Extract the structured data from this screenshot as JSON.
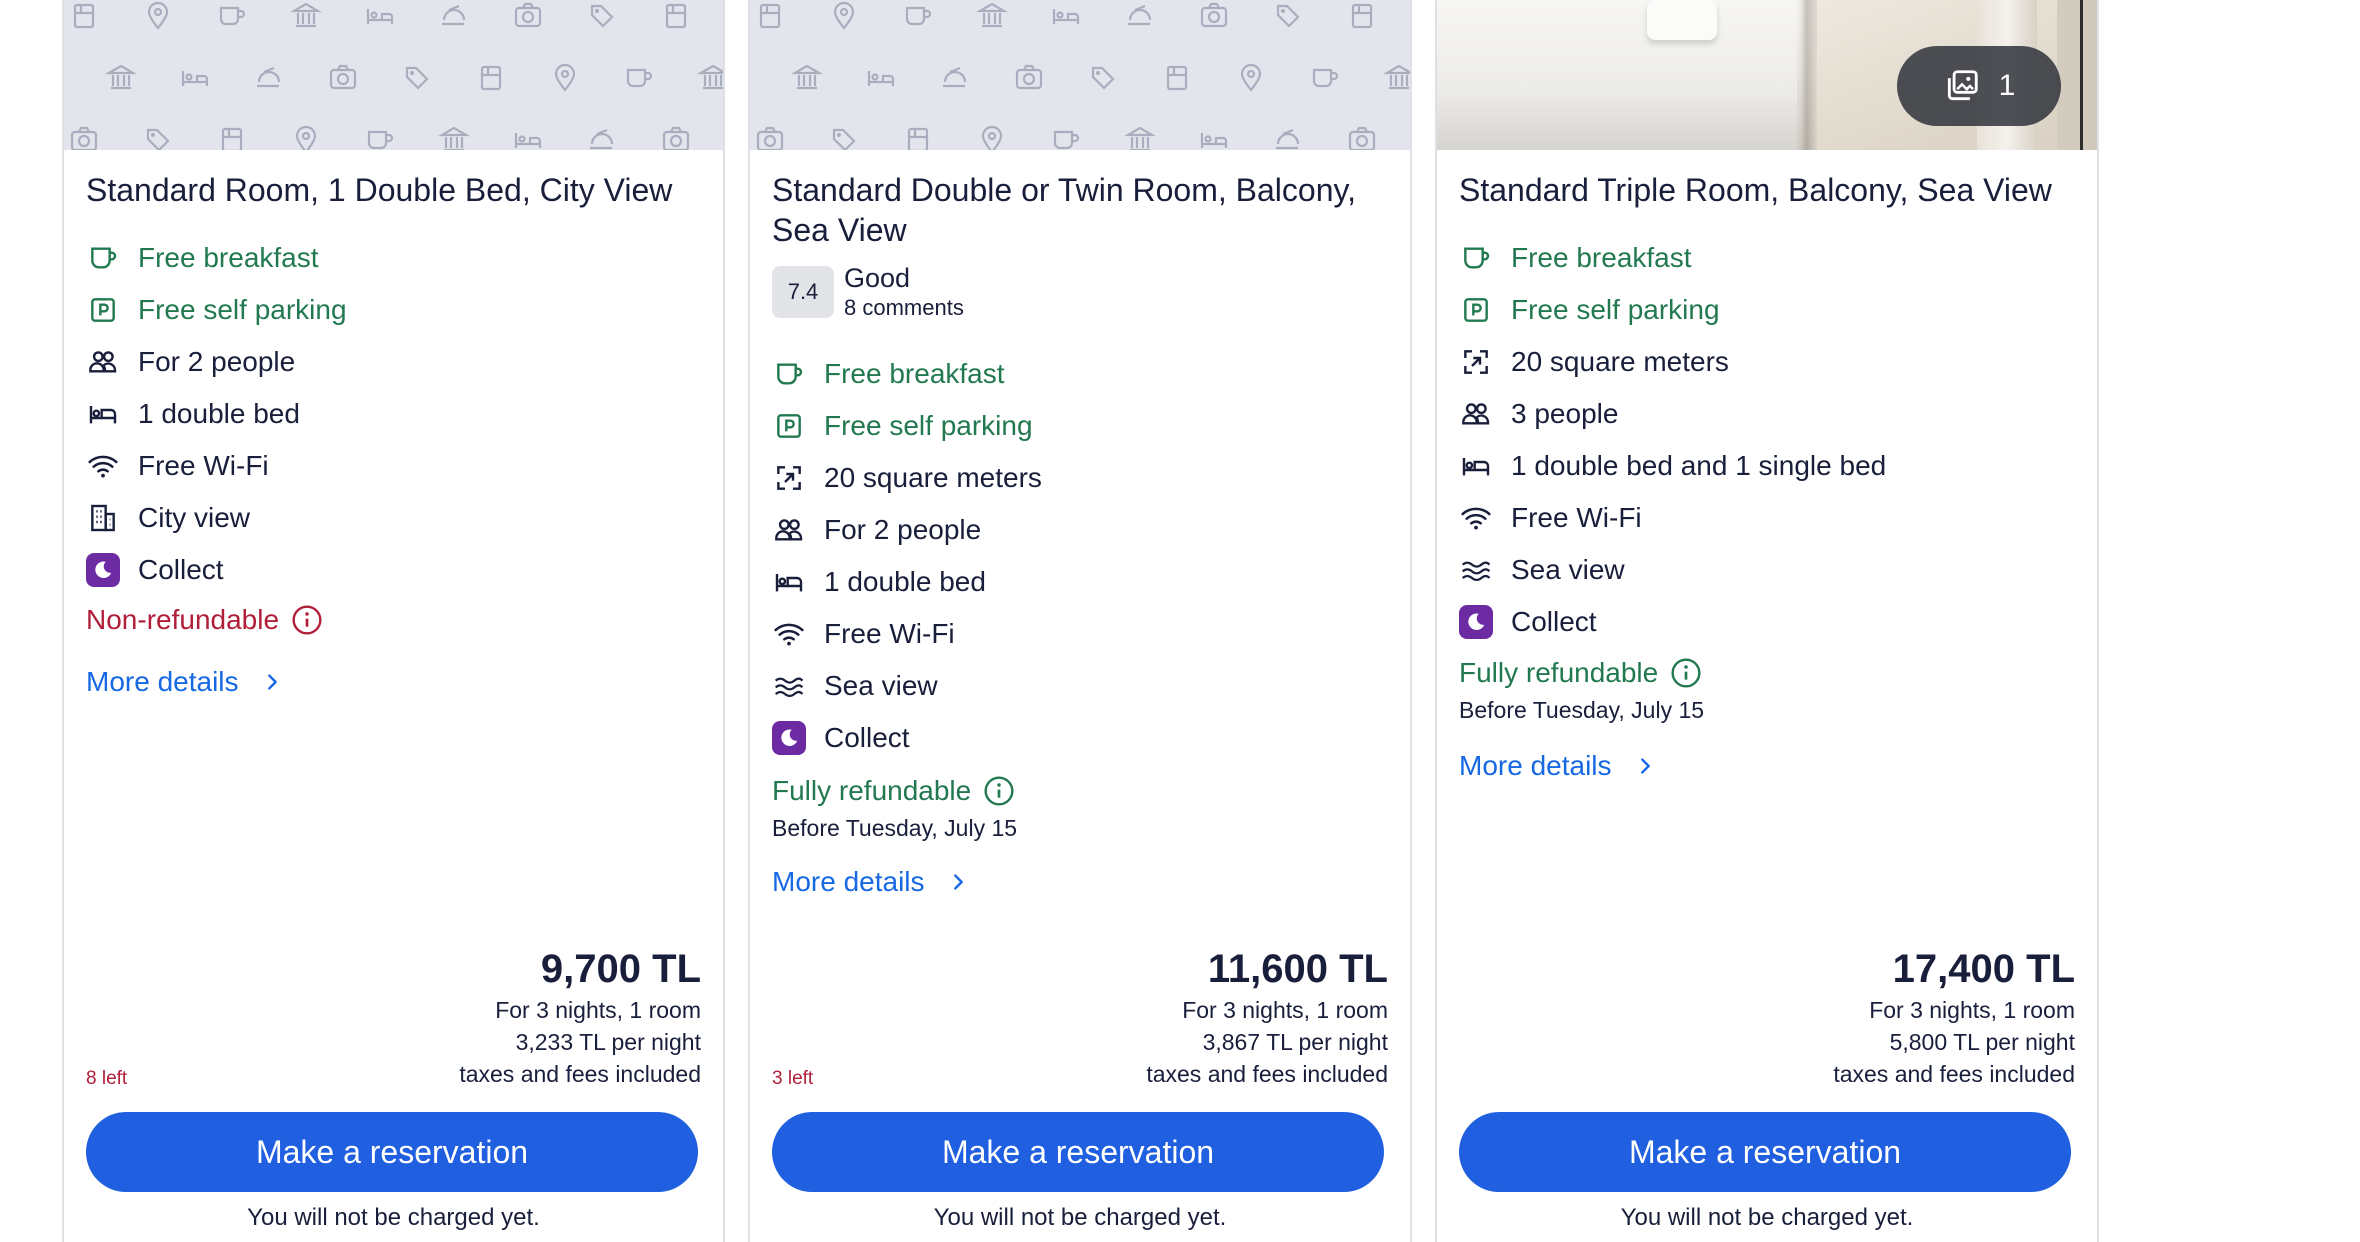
{
  "cards": [
    {
      "title": "Standard Room, 1 Double Bed, City View",
      "media": "placeholder",
      "features": [
        {
          "text": "Free breakfast",
          "icon": "coffee-icon",
          "color": "green"
        },
        {
          "text": "Free self parking",
          "icon": "parking-icon",
          "color": "green"
        },
        {
          "text": "For 2 people",
          "icon": "people-icon",
          "color": "default"
        },
        {
          "text": "1 double bed",
          "icon": "bed-icon",
          "color": "default"
        },
        {
          "text": "Free Wi-Fi",
          "icon": "wifi-icon",
          "color": "default"
        },
        {
          "text": "City view",
          "icon": "city-icon",
          "color": "default"
        },
        {
          "text": "Collect",
          "icon": "collect-moon-icon",
          "color": "default"
        }
      ],
      "refund": {
        "text": "Non-refundable",
        "status": "non-refundable"
      },
      "more_details": "More details",
      "price": "9,700 TL",
      "stay": "For 3 nights, 1 room",
      "per_night": "3,233 TL per night",
      "taxes": "taxes and fees included",
      "left": "8 left",
      "reserve_label": "Make a reservation",
      "charge_note": "You will not be charged yet."
    },
    {
      "title": "Standard Double or Twin Room, Balcony, Sea View",
      "media": "placeholder",
      "rating": {
        "score": "7.4",
        "label": "Good",
        "count": "8 comments"
      },
      "features": [
        {
          "text": "Free breakfast",
          "icon": "coffee-icon",
          "color": "green"
        },
        {
          "text": "Free self parking",
          "icon": "parking-icon",
          "color": "green"
        },
        {
          "text": "20 square meters",
          "icon": "expand-icon",
          "color": "default"
        },
        {
          "text": "For 2 people",
          "icon": "people-icon",
          "color": "default"
        },
        {
          "text": "1 double bed",
          "icon": "bed-icon",
          "color": "default"
        },
        {
          "text": "Free Wi-Fi",
          "icon": "wifi-icon",
          "color": "default"
        },
        {
          "text": "Sea view",
          "icon": "waves-icon",
          "color": "default"
        },
        {
          "text": "Collect",
          "icon": "collect-moon-icon",
          "color": "default"
        }
      ],
      "refund": {
        "text": "Fully refundable",
        "status": "refundable",
        "date": "Before Tuesday, July 15"
      },
      "more_details": "More details",
      "price": "11,600 TL",
      "stay": "For 3 nights, 1 room",
      "per_night": "3,867 TL per night",
      "taxes": "taxes and fees included",
      "left": "3 left",
      "reserve_label": "Make a reservation",
      "charge_note": "You will not be charged yet."
    },
    {
      "title": "Standard Triple Room, Balcony, Sea View",
      "media": "photo",
      "photo_count": "1",
      "features": [
        {
          "text": "Free breakfast",
          "icon": "coffee-icon",
          "color": "green"
        },
        {
          "text": "Free self parking",
          "icon": "parking-icon",
          "color": "green"
        },
        {
          "text": "20 square meters",
          "icon": "expand-icon",
          "color": "default"
        },
        {
          "text": "3 people",
          "icon": "people-icon",
          "color": "default"
        },
        {
          "text": "1 double bed and 1 single bed",
          "icon": "bed-icon",
          "color": "default"
        },
        {
          "text": "Free Wi-Fi",
          "icon": "wifi-icon",
          "color": "default"
        },
        {
          "text": "Sea view",
          "icon": "waves-icon",
          "color": "default"
        },
        {
          "text": "Collect",
          "icon": "collect-moon-icon",
          "color": "default"
        }
      ],
      "refund": {
        "text": "Fully refundable",
        "status": "refundable",
        "date": "Before Tuesday, July 15"
      },
      "more_details": "More details",
      "price": "17,400 TL",
      "stay": "For 3 nights, 1 room",
      "per_night": "5,800 TL per night",
      "taxes": "taxes and fees included",
      "left": "",
      "reserve_label": "Make a reservation",
      "charge_note": "You will not be charged yet."
    }
  ],
  "colors": {
    "green": "#227950",
    "red": "#b11e3a",
    "link": "#1668e3",
    "button": "#1f5fe0",
    "collect": "#6c2ba3"
  }
}
